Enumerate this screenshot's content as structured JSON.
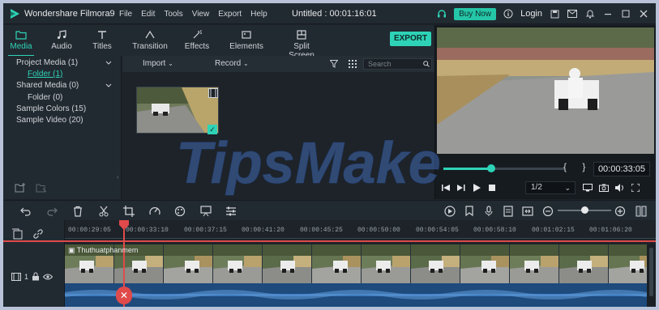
{
  "app": {
    "name": "Wondershare Filmora9",
    "window_title": "Untitled : 00:01:16:01",
    "menu": [
      "File",
      "Edit",
      "Tools",
      "View",
      "Export",
      "Help"
    ],
    "buy_now": "Buy Now",
    "login": "Login"
  },
  "tabs": [
    {
      "label": "Media",
      "icon": "folder-icon",
      "active": true
    },
    {
      "label": "Audio",
      "icon": "music-note-icon",
      "active": false
    },
    {
      "label": "Titles",
      "icon": "text-icon",
      "active": false
    },
    {
      "label": "Transition",
      "icon": "transition-icon",
      "active": false
    },
    {
      "label": "Effects",
      "icon": "effects-icon",
      "active": false
    },
    {
      "label": "Elements",
      "icon": "elements-icon",
      "active": false
    },
    {
      "label": "Split Screen",
      "icon": "split-screen-icon",
      "active": false
    }
  ],
  "export_label": "EXPORT",
  "library": {
    "items": [
      {
        "label": "Project Media (1)",
        "expandable": true
      },
      {
        "label": "Folder (1)",
        "selected": true
      },
      {
        "label": "Shared Media (0)",
        "expandable": true
      },
      {
        "label": "Folder (0)"
      },
      {
        "label": "Sample Colors (15)"
      },
      {
        "label": "Sample Video (20)"
      }
    ]
  },
  "media_toolbar": {
    "import": "Import",
    "record": "Record",
    "search_placeholder": "Search"
  },
  "preview": {
    "timecode": "00:00:33:05",
    "quality": "1/2",
    "progress": 0.39
  },
  "watermark": "TipsMake",
  "timeline": {
    "ruler_labels": [
      "00:00:29:05",
      "00:00:33:10",
      "00:00:37:15",
      "00:00:41:20",
      "00:00:45:25",
      "00:00:50:00",
      "00:00:54:05",
      "00:00:58:10",
      "00:01:02:15",
      "00:01:06:20"
    ],
    "clip_label": "Thuthuatphanmem",
    "track_number": "1",
    "zoom_level": 0.5
  },
  "colors": {
    "accent": "#2ed3b7",
    "playhead": "#e04a4a",
    "audio_track": "#1e4a7c",
    "panel": "#222a31"
  }
}
